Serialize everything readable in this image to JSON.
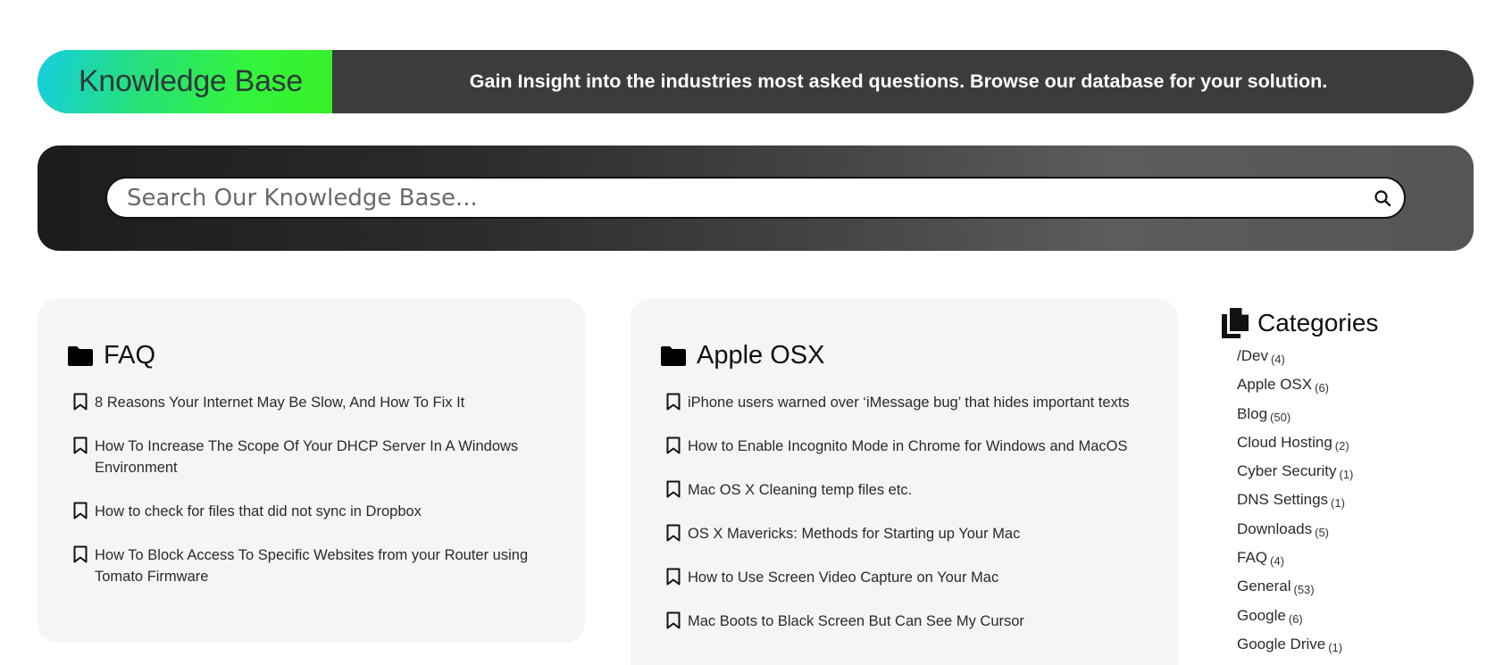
{
  "hero": {
    "badge": "Knowledge Base",
    "tagline": "Gain Insight into the industries most asked questions. Browse our database for your solution."
  },
  "search": {
    "placeholder": "Search Our Knowledge Base...",
    "icon": "search-icon"
  },
  "cards": [
    {
      "title": "FAQ",
      "icon": "folder-icon",
      "posts": [
        "8 Reasons Your Internet May Be Slow, And How To Fix It",
        "How To Increase The Scope Of Your DHCP Server In A Windows Environment",
        "How to check for files that did not sync in Dropbox",
        "How To Block Access To Specific Websites from your Router using Tomato Firmware"
      ]
    },
    {
      "title": "Apple OSX",
      "icon": "folder-icon",
      "posts": [
        "iPhone users warned over ‘iMessage bug’ that hides important texts",
        "How to Enable Incognito Mode in Chrome for Windows and MacOS",
        "Mac OS X Cleaning temp files etc.",
        "OS X Mavericks: Methods for Starting up Your Mac",
        "How to Use Screen Video Capture on Your Mac",
        "Mac Boots to Black Screen But Can See My Cursor"
      ]
    }
  ],
  "sidebar": {
    "title": "Categories",
    "icon": "documents-icon",
    "categories": [
      {
        "name": "/Dev",
        "count": "(4)"
      },
      {
        "name": "Apple OSX",
        "count": "(6)"
      },
      {
        "name": "Blog",
        "count": "(50)"
      },
      {
        "name": "Cloud Hosting",
        "count": "(2)"
      },
      {
        "name": "Cyber Security",
        "count": "(1)"
      },
      {
        "name": "DNS Settings",
        "count": "(1)"
      },
      {
        "name": "Downloads",
        "count": "(5)"
      },
      {
        "name": "FAQ",
        "count": "(4)"
      },
      {
        "name": "General",
        "count": "(53)"
      },
      {
        "name": "Google",
        "count": "(6)"
      },
      {
        "name": "Google Drive",
        "count": "(1)"
      }
    ]
  }
}
